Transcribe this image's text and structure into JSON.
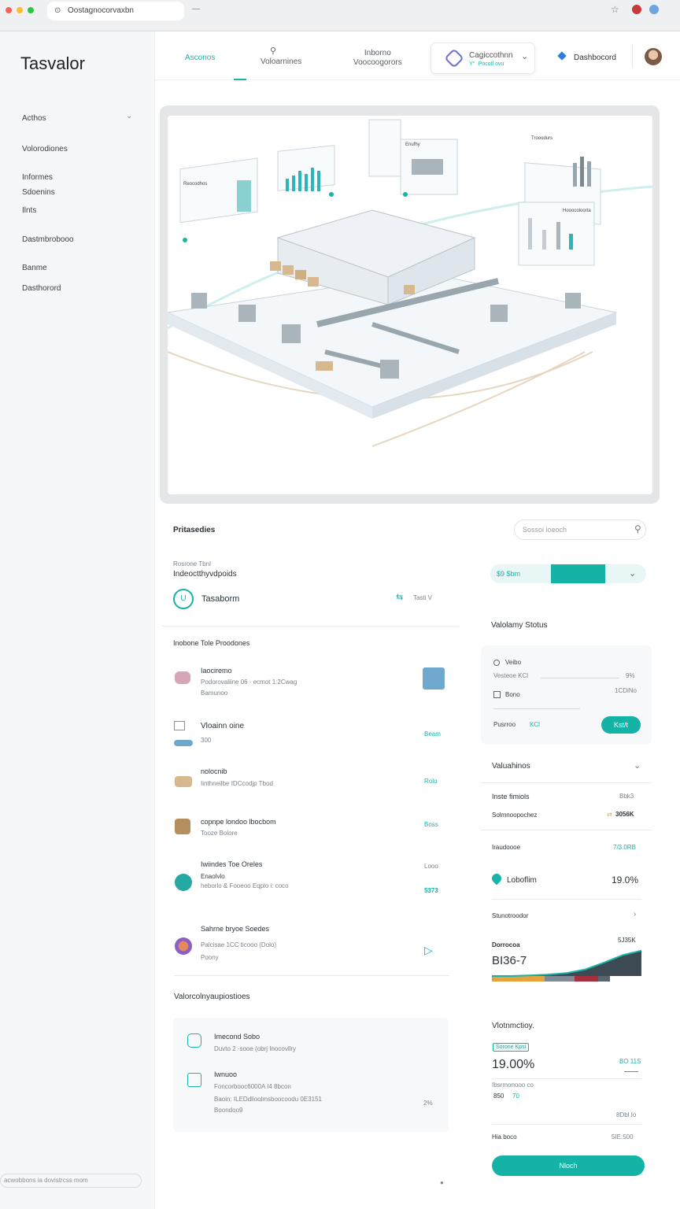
{
  "browser": {
    "url": "Oostagnocorvaxbn",
    "colors": {
      "red": "#ff5f57",
      "yellow": "#febc2e",
      "green": "#28c840"
    }
  },
  "sidebar": {
    "brand": "Tasvalor",
    "items": [
      {
        "label": "Acthos"
      },
      {
        "label": "Volorodiones"
      },
      {
        "label": "Informes"
      },
      {
        "label": "Sdoenins"
      },
      {
        "label": "Ilnts"
      },
      {
        "label": "Dastmbrobooo"
      },
      {
        "label": "Banme"
      },
      {
        "label": "Dasthorord"
      }
    ],
    "search_text": "acwobbons ia dovistrcss mom"
  },
  "topnav": {
    "tabs": [
      {
        "label": "Asconos"
      },
      {
        "label": "Voloarnines"
      },
      {
        "label": "Inborno",
        "sub": "Voocoogorors"
      }
    ],
    "profile_card": {
      "title": "Cagiccothnn",
      "sub": "Y° ·Pocotl ovu"
    },
    "dashboard_label": "Dashbocord"
  },
  "hero": {
    "panel_labels": [
      "Reocodhos",
      "Enufhy",
      "Trooodurs",
      "Hooocoloorta"
    ]
  },
  "left": {
    "section_title": "Pritasedies",
    "field_label": "Rosrone Tbnl",
    "field_value": "Indeoctthyvdpoids",
    "selector_value": "Tasaborm",
    "selector_extra": "Tasti V",
    "list_title": "Inobone Tole Proodones",
    "list": [
      {
        "title": "Iaociremo",
        "line1": "Podorovaliine 06 · ecmot 1:2Cwag",
        "line2": "Bamunoo",
        "status": ""
      },
      {
        "title": "Vloainn oine",
        "line1": "300",
        "line2": "",
        "status": "Beam"
      },
      {
        "title": "nolocnib",
        "line1": "Iinthneilbe IDCcodjp Tbod",
        "line2": "",
        "status": "Rolo"
      },
      {
        "title": "copnpe londoo lbocbom",
        "line1": "Tooze Bolore",
        "line2": "",
        "status": "Boss"
      },
      {
        "title": "Iwiindes Toe Oreles",
        "line1": "Enaolvlo",
        "line2": "heborlo & Fooeoo Eqplo i: coco",
        "status": "Looo",
        "value": "5373"
      }
    ],
    "extra": {
      "title": "Sahrne bryoe Soedes",
      "line1": "Palcisae 1CC ticooo (Dolo)",
      "line2": "Poony"
    },
    "bottom_title": "Valorcolnyaupiostioes",
    "bottom_items": [
      {
        "title": "Imecond Sobo",
        "line1": "Duvto 2 ·sooe (obrj Inocovllry"
      },
      {
        "title": "Iwnuoo",
        "line1": "Foncorbooc6000A I4 8bcon",
        "line2": "Baoin: ILEDdlioolmsboocoodu 0E3151",
        "line3": "Boondoo9",
        "value": "2%"
      }
    ]
  },
  "right": {
    "search_placeholder": "Sossoi ioeoch",
    "slider": {
      "label": "$9 $bm",
      "fill_pct": 0.35
    },
    "status_title": "Valolamy Stotus",
    "status_card": {
      "row1_label": "Veibo",
      "row1_sub": "Vesteoe KCl",
      "row1_val": "9%",
      "row2_label": "Bono",
      "row2_val": "1CDiNo",
      "row3_label": "Pusrroo",
      "row3_val": "KCl",
      "button": "Kst/t"
    },
    "valuations_title": "Valuahinos",
    "valuations": [
      {
        "label": "Inste fimiols",
        "value": "Bbk3"
      },
      {
        "label": "Solmnoopochez",
        "value": "3056K"
      },
      {
        "label": "Iraudoooe",
        "value": "7/3.0RB"
      },
      {
        "label": "Loboflim",
        "value": "19.0%"
      },
      {
        "label": "Stunotroodor",
        "value": ""
      }
    ],
    "chart_block": {
      "label": "Dorrocoa",
      "value": "BI36-7",
      "corner": "5J35K"
    },
    "chart_data": {
      "type": "area",
      "values": [
        0.0,
        0.0,
        0.02,
        0.05,
        0.1,
        0.22,
        0.45,
        0.7,
        0.85
      ]
    },
    "valuation_card": {
      "title": "Vlotnmctioy.",
      "tag": "Sorone Kpsi",
      "big": "19.00%",
      "big_right": "BO 11S",
      "sub1": "Ibsrmonooo co",
      "sub2": "850",
      "sub2_teal": "70",
      "row_right": "8Dbl Io",
      "row2_label": "Hia boco",
      "row2_val": "5IE.500",
      "button": "Nloch"
    }
  }
}
